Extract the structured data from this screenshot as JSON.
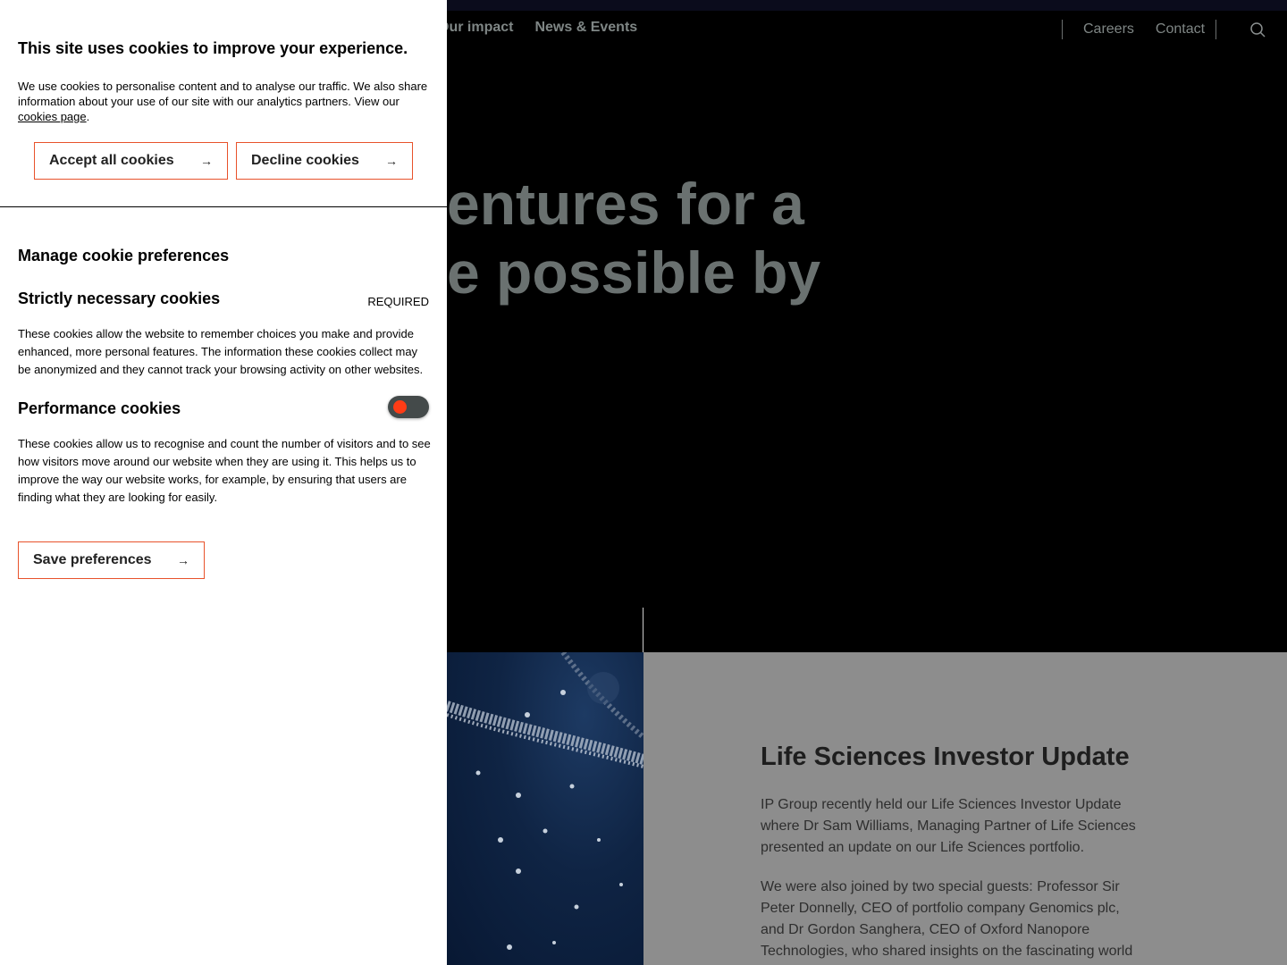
{
  "nav": {
    "items": [
      "Our impact",
      "News & Events"
    ],
    "utility": [
      "Careers",
      "Contact"
    ],
    "search_icon": "search-icon"
  },
  "hero": {
    "line1": "entures for a",
    "line2": "e possible by"
  },
  "news": {
    "title": "Life Sciences Investor Update",
    "paragraph1": "IP Group recently held our Life Sciences Investor Update where Dr Sam Williams, Managing Partner of Life Sciences presented an update on our Life Sciences portfolio.",
    "paragraph2": "We were also joined by two special guests: Professor Sir Peter Donnelly, CEO of portfolio company Genomics plc, and Dr Gordon Sanghera, CEO of Oxford Nanopore Technologies, who shared insights on the fascinating world"
  },
  "cookie": {
    "title": "This site uses cookies to improve your experience.",
    "intro_text": "We use cookies to personalise content and to analyse our traffic. We also share information about your use of our site with our analytics partners. View our",
    "intro_link": "cookies page",
    "intro_end": ".",
    "accept_label": "Accept all cookies",
    "decline_label": "Decline cookies",
    "manage_title": "Manage cookie preferences",
    "strict": {
      "title": "Strictly necessary cookies",
      "badge": "REQUIRED",
      "description": "These cookies allow the website to remember choices you make and provide enhanced, more personal features. The information these cookies collect may be anonymized and they cannot track your browsing activity on other websites."
    },
    "performance": {
      "title": "Performance cookies",
      "enabled": false,
      "description": "These cookies allow us to recognise and count the number of visitors and to see how visitors move around our website when they are using it. This helps us to improve the way our website works, for example, by ensuring that users are finding what they are looking for easily."
    },
    "save_label": "Save preferences",
    "arrow": "→"
  },
  "colors": {
    "accent": "#e8522b",
    "toggle_knob": "#ff3c16",
    "panel_bg": "#ffffff",
    "page_bg": "#000000",
    "news_bg": "#8d8d8d"
  }
}
